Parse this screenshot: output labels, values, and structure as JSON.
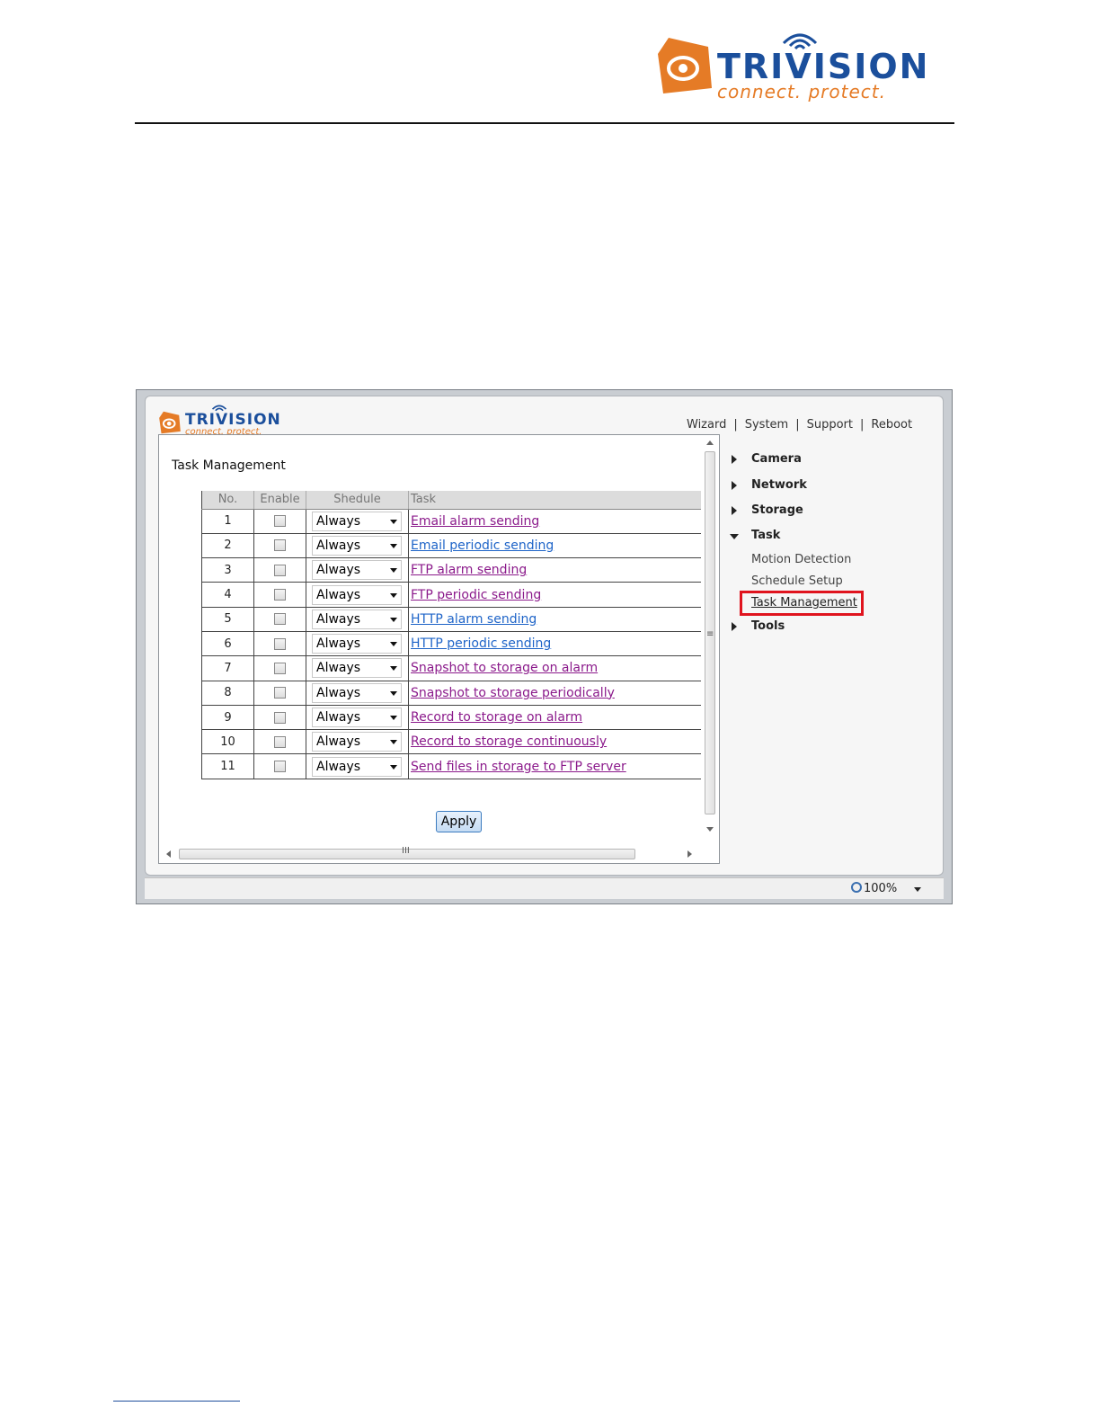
{
  "doc_header": {
    "brand": "TRIVISION",
    "tagline": "connect. protect."
  },
  "app": {
    "brand": "TRIVISION",
    "tagline": "connect. protect.",
    "topnav": [
      "Wizard",
      "System",
      "Support",
      "Reboot"
    ],
    "page_title": "Task Management",
    "table": {
      "headers": [
        "No.",
        "Enable",
        "Shedule",
        "Task"
      ],
      "rows": [
        {
          "no": "1",
          "schedule": "Always",
          "task": "Email alarm sending",
          "visited": true
        },
        {
          "no": "2",
          "schedule": "Always",
          "task": "Email periodic sending",
          "visited": false
        },
        {
          "no": "3",
          "schedule": "Always",
          "task": "FTP alarm sending",
          "visited": true
        },
        {
          "no": "4",
          "schedule": "Always",
          "task": "FTP periodic sending",
          "visited": true
        },
        {
          "no": "5",
          "schedule": "Always",
          "task": "HTTP alarm sending",
          "visited": false
        },
        {
          "no": "6",
          "schedule": "Always",
          "task": "HTTP periodic sending",
          "visited": false
        },
        {
          "no": "7",
          "schedule": "Always",
          "task": "Snapshot to storage on alarm",
          "visited": true
        },
        {
          "no": "8",
          "schedule": "Always",
          "task": "Snapshot to storage periodically",
          "visited": true
        },
        {
          "no": "9",
          "schedule": "Always",
          "task": "Record to storage on alarm",
          "visited": true
        },
        {
          "no": "10",
          "schedule": "Always",
          "task": "Record to storage continuously",
          "visited": true
        },
        {
          "no": "11",
          "schedule": "Always",
          "task": "Send files in storage to FTP server",
          "visited": true
        }
      ]
    },
    "apply_label": "Apply",
    "scroll_grip": "III",
    "vscroll_grip": "≡",
    "menu": {
      "camera": "Camera",
      "network": "Network",
      "storage": "Storage",
      "task": "Task",
      "task_sub": [
        "Motion Detection",
        "Schedule Setup",
        "Task Management"
      ],
      "tools": "Tools"
    },
    "status": {
      "zoom": "100%"
    }
  },
  "colors": {
    "brand_blue": "#1b4f9c",
    "brand_orange": "#e57b26",
    "link_visited": "#8b1a8b",
    "link_unvisited": "#1e64c8",
    "highlight": "#e0141e"
  }
}
